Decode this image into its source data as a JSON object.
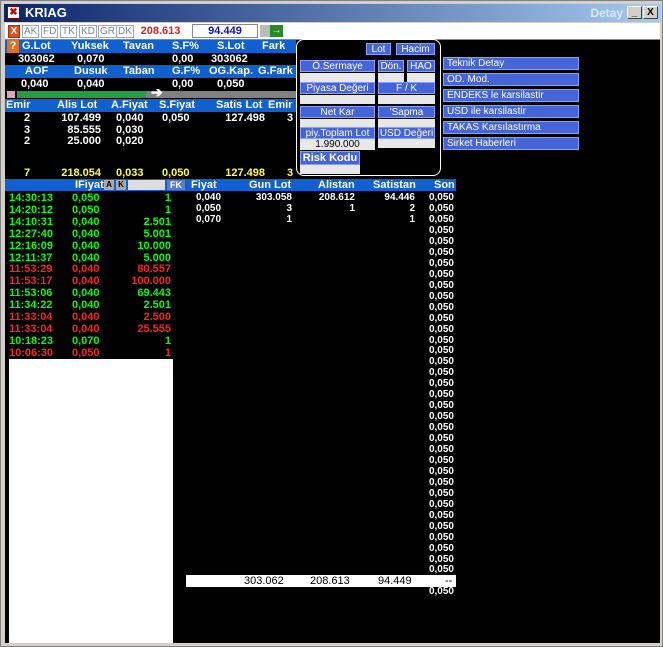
{
  "window": {
    "title": "KRIAG",
    "right_label": "Detay",
    "min_label": "_",
    "close_label": "X"
  },
  "toolbar": {
    "close_label": "X",
    "buttons": [
      "AK",
      "FD",
      "TK",
      "KD",
      "GR",
      "DK"
    ],
    "value1": "208.613",
    "value2": "94.449",
    "go_label": "→"
  },
  "summary": {
    "question_label": "?",
    "row1_headers": [
      "G.Lot",
      "Yuksek",
      "Tavan",
      "S.F%",
      "S.Lot",
      "Fark"
    ],
    "row1_values": [
      "303062",
      "0,070",
      "",
      "0,00",
      "303062",
      ""
    ],
    "row2_headers": [
      "AOF",
      "Dusuk",
      "Taban",
      "G.F%",
      "OG.Kap.",
      "G.Fark"
    ],
    "row2_values": [
      "0,040",
      "0,040",
      "",
      "0,00",
      "0,050",
      ""
    ],
    "arrow": "➔"
  },
  "depth": {
    "headers": [
      "Emir",
      "Alis Lot",
      "A.Fiyat",
      "S.Fiyat",
      "Satis Lot",
      "Emir"
    ],
    "rows": [
      [
        "2",
        "107.499",
        "0,040",
        "0,050",
        "127.498",
        "3"
      ],
      [
        "3",
        "85.555",
        "0,030",
        "",
        "",
        ""
      ],
      [
        "2",
        "25.000",
        "0,020",
        "",
        "",
        ""
      ]
    ],
    "total": [
      "7",
      "218.054",
      "0,033",
      "0,050",
      "127.498",
      "3"
    ]
  },
  "popup": {
    "lot_label": "Lot",
    "hacim_label": "Hacim",
    "sermaye_label": "Ö.Sermaye",
    "don_label": "Dön.",
    "hao_label": "HAO",
    "piyasa_label": "Piyasa Değeri",
    "fk_label": "F / K",
    "netkar_label": "Net Kar",
    "sapma_label": "'Sapma",
    "toplam_label": "piy.Toplam Lot",
    "usd_label": "USD Değeri",
    "toplam_value": "1.990.000",
    "risk_label": "Risk Kodu"
  },
  "menu": {
    "items": [
      "Teknik Detay",
      "OD. Mod.",
      "ENDEKS le karsilastir",
      "USD ile karsilastir",
      "TAKAS Karsılastırma",
      "Sirket Haberleri"
    ]
  },
  "trades": {
    "headers": [
      "IFiyat",
      "A",
      "K",
      "FK"
    ],
    "rows": [
      {
        "time": "14:30:13",
        "price": "0,050",
        "qty": "1",
        "color": "#00ff00"
      },
      {
        "time": "14:20:12",
        "price": "0,050",
        "qty": "1",
        "color": "#00ff00"
      },
      {
        "time": "14:10:31",
        "price": "0,040",
        "qty": "2.501",
        "color": "#00ff00"
      },
      {
        "time": "12:27:40",
        "price": "0,040",
        "qty": "5.001",
        "color": "#00ff00"
      },
      {
        "time": "12:16:09",
        "price": "0,040",
        "qty": "10.000",
        "color": "#00ff00"
      },
      {
        "time": "12:11:37",
        "price": "0,040",
        "qty": "5.000",
        "color": "#00ff00"
      },
      {
        "time": "11:53:29",
        "price": "0,040",
        "qty": "80.557",
        "color": "#ff2020"
      },
      {
        "time": "11:53:17",
        "price": "0,040",
        "qty": "100.000",
        "color": "#ff2020"
      },
      {
        "time": "11:53:06",
        "price": "0,040",
        "qty": "69.443",
        "color": "#00ff00"
      },
      {
        "time": "11:34:22",
        "price": "0,040",
        "qty": "2.501",
        "color": "#00ff00"
      },
      {
        "time": "11:33:04",
        "price": "0,040",
        "qty": "2.500",
        "color": "#ff2020"
      },
      {
        "time": "11:33:04",
        "price": "0,040",
        "qty": "25.555",
        "color": "#ff2020"
      },
      {
        "time": "10:18:23",
        "price": "0,070",
        "qty": "1",
        "color": "#00ff00"
      },
      {
        "time": "10:06:30",
        "price": "0,050",
        "qty": "1",
        "color": "#ff2020"
      }
    ]
  },
  "volume": {
    "headers": [
      "Fiyat",
      "Gun Lot",
      "Alistan",
      "Satistan",
      "Son"
    ],
    "rows": [
      [
        "0,040",
        "303.058",
        "208.612",
        "94.446",
        "0,050"
      ],
      [
        "0,050",
        "3",
        "1",
        "2",
        "0,050"
      ],
      [
        "0,070",
        "1",
        "",
        "1",
        "0,050"
      ]
    ],
    "son_column_extra": "0,050",
    "totals": [
      "303.062",
      "208.613",
      "94.449",
      "--"
    ]
  }
}
